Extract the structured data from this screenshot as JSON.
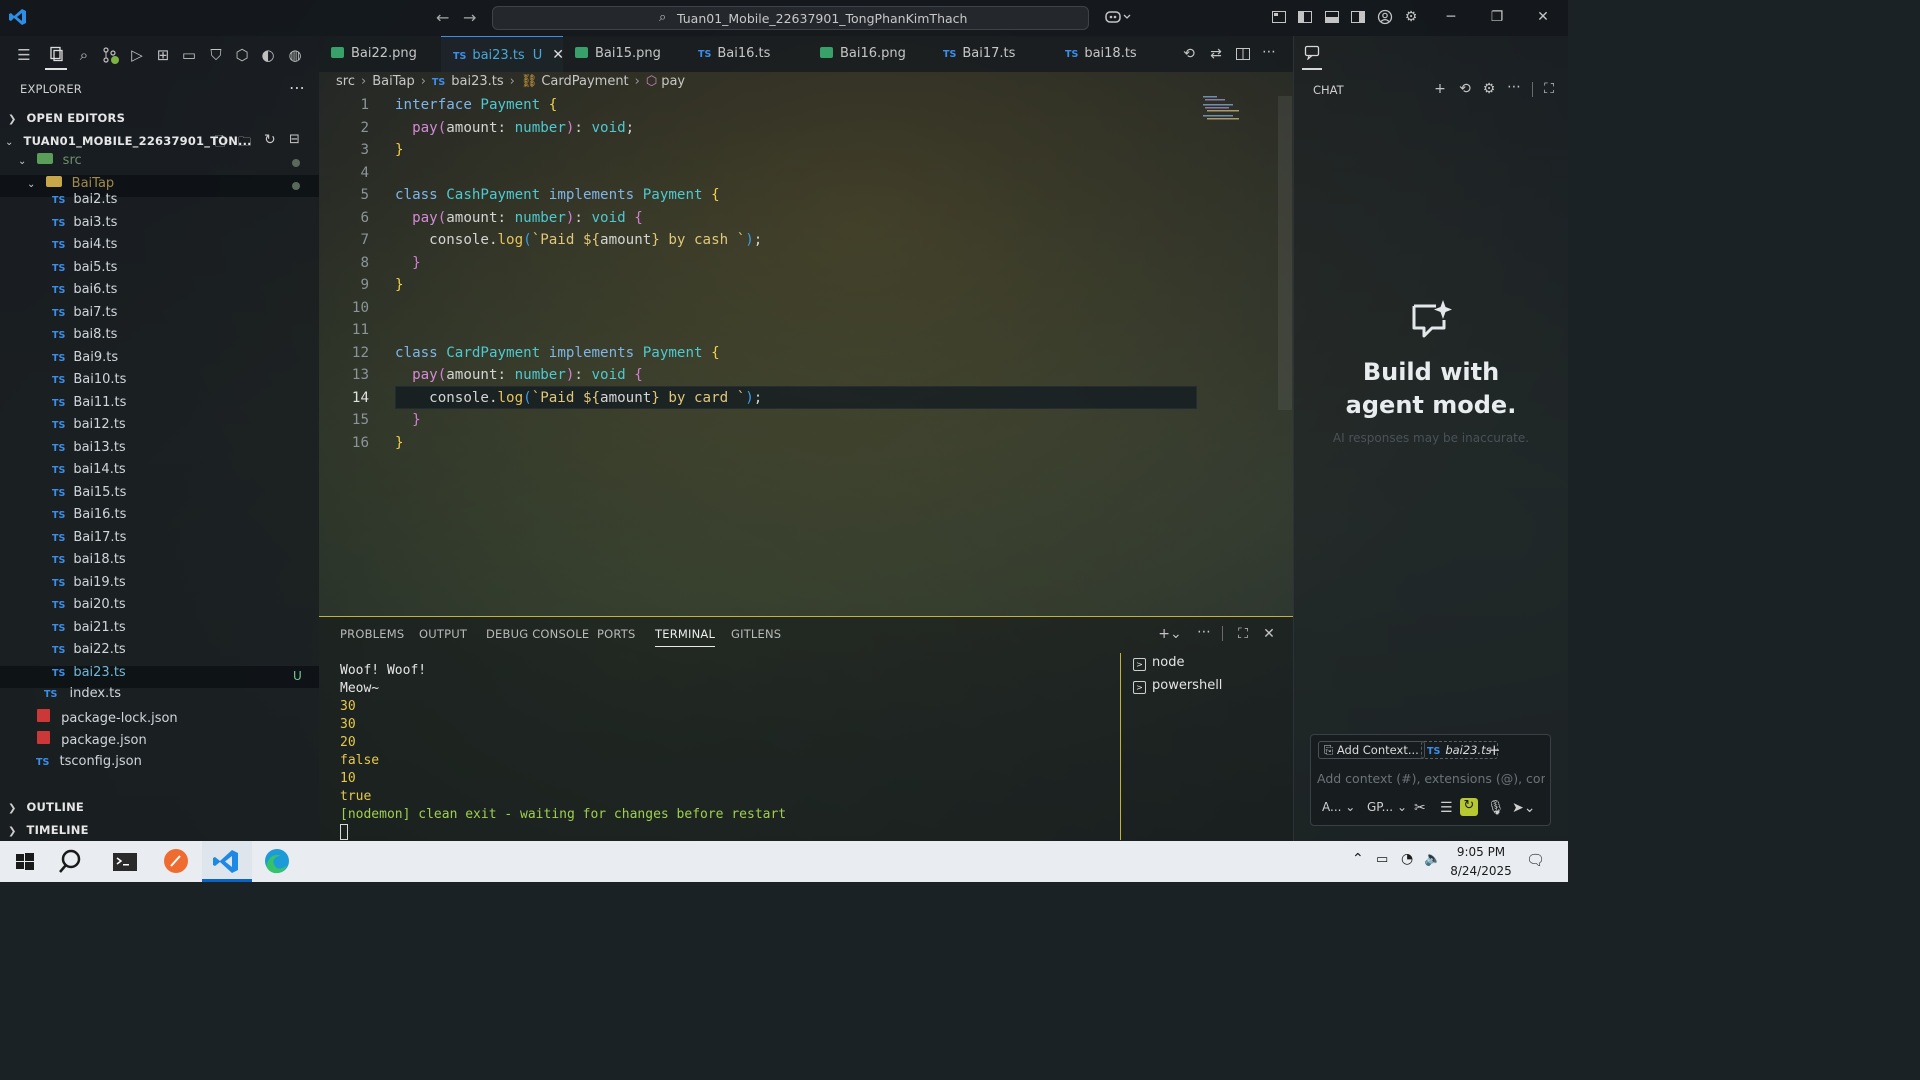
{
  "window": {
    "title": "Tuan01_Mobile_22637901_TongPhanKimThach"
  },
  "sidebar": {
    "explorer_title": "EXPLORER",
    "open_editors": "OPEN EDITORS",
    "workspace": "TUAN01_MOBILE_22637901_TON...",
    "folder_src": "src",
    "folder_baitap": "BaiTap",
    "files": [
      "bai2.ts",
      "bai3.ts",
      "bai4.ts",
      "bai5.ts",
      "bai6.ts",
      "bai7.ts",
      "bai8.ts",
      "Bai9.ts",
      "Bai10.ts",
      "Bai11.ts",
      "bai12.ts",
      "bai13.ts",
      "bai14.ts",
      "Bai15.ts",
      "Bai16.ts",
      "Bai17.ts",
      "bai18.ts",
      "bai19.ts",
      "bai20.ts",
      "bai21.ts",
      "bai22.ts",
      "bai23.ts"
    ],
    "active_file_flag": "U",
    "root_files": [
      "index.ts",
      "package-lock.json",
      "package.json",
      "tsconfig.json"
    ],
    "outline": "OUTLINE",
    "timeline": "TIMELINE"
  },
  "tabs": [
    {
      "label": "Bai22.png",
      "kind": "png"
    },
    {
      "label": "bai23.ts",
      "kind": "ts",
      "flag": "U",
      "active": true
    },
    {
      "label": "Bai15.png",
      "kind": "png"
    },
    {
      "label": "Bai16.ts",
      "kind": "ts"
    },
    {
      "label": "Bai16.png",
      "kind": "png"
    },
    {
      "label": "Bai17.ts",
      "kind": "ts"
    },
    {
      "label": "bai18.ts",
      "kind": "ts"
    }
  ],
  "breadcrumb": [
    "src",
    "BaiTap",
    "bai23.ts",
    "CardPayment",
    "pay"
  ],
  "editor": {
    "line_numbers": [
      "1",
      "2",
      "3",
      "4",
      "5",
      "6",
      "7",
      "8",
      "9",
      "10",
      "11",
      "12",
      "13",
      "14",
      "15",
      "16"
    ],
    "current_line": 14
  },
  "panel": {
    "tabs": [
      "PROBLEMS",
      "OUTPUT",
      "DEBUG CONSOLE",
      "PORTS",
      "TERMINAL",
      "GITLENS"
    ],
    "active_tab": "TERMINAL",
    "terminal_lines": [
      "Woof! Woof!",
      "Meow~",
      "30",
      "30",
      "20",
      "false",
      "10",
      "true",
      "[nodemon] clean exit - waiting for changes before restart"
    ],
    "terminal_sessions": [
      "node",
      "powershell"
    ]
  },
  "chat": {
    "title": "CHAT",
    "hero": "Build with agent mode.",
    "disclaimer": "AI responses may be inaccurate.",
    "add_context": "Add Context...",
    "context_file": "bai23.ts",
    "placeholder": "Add context (#), extensions (@), commands",
    "mode": "A...",
    "model": "GP..."
  },
  "taskbar": {
    "time": "9:05 PM",
    "date": "8/24/2025"
  },
  "colors": {
    "accent": "#3b8eea",
    "ts_badge": "#3b8eea",
    "panel_border": "#c2b23a",
    "taskbar": "#e9edf2"
  }
}
